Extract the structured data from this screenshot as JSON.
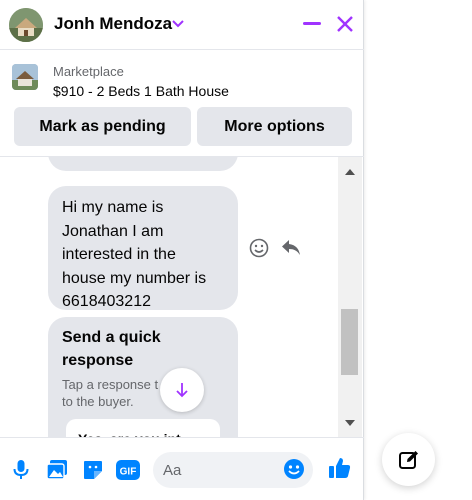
{
  "header": {
    "contact_name": "Jonh Mendoza",
    "accent_color": "#a033ff"
  },
  "marketplace": {
    "label": "Marketplace",
    "listing_title": "$910 - 2 Beds 1 Bath House"
  },
  "actions": {
    "mark_pending": "Mark as pending",
    "more_options": "More options"
  },
  "messages": [
    {
      "lines": [
        "Hi my name is",
        "Jonathan I am",
        "interested in the",
        "house my number is",
        "6618403212"
      ]
    }
  ],
  "quick_response": {
    "title_line1": "Send a quick",
    "title_line2": "response",
    "subtitle_line1": "Tap a response t     d it",
    "subtitle_line2": "to the buyer.",
    "option": "Yes, are you int..."
  },
  "composer": {
    "placeholder": "Aa",
    "icon_color": "#0084ff"
  },
  "icons": [
    "microphone-icon",
    "photo-icon",
    "sticker-icon",
    "gif-icon",
    "emoji-icon",
    "thumbs-up-icon",
    "new-message-icon",
    "smiley-react-icon",
    "reply-icon",
    "arrow-down-icon",
    "minimize-icon",
    "close-icon",
    "chevron-down-icon"
  ],
  "gif_label": "GIF"
}
